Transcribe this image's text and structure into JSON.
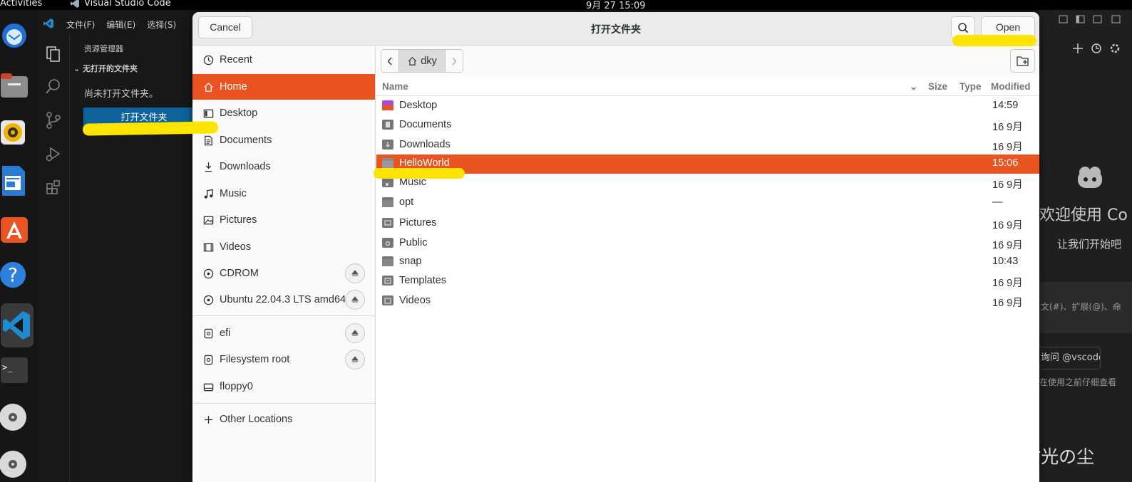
{
  "topbar": {
    "activities": "Activities",
    "app_name": "Visual Studio Code",
    "clock": "9月 27  15:09"
  },
  "dock": {
    "help_tooltip": "Help"
  },
  "vscode": {
    "menus": [
      "文件(F)",
      "编辑(E)",
      "选择(S)"
    ],
    "explorer_title": "资源管理器",
    "no_folder_section": "无打开的文件夹",
    "no_folder_message": "尚未打开文件夹。",
    "open_folder_button": "打开文件夹",
    "welcome_title": "欢迎使用 Co",
    "welcome_subtitle": "让我们开始吧",
    "chat_placeholder": "文(#)、扩展(@)、命",
    "ask_button": "询问 @vscode",
    "hint_text": "在使用之前仔细查看"
  },
  "dialog": {
    "title": "打开文件夹",
    "cancel_label": "Cancel",
    "open_label": "Open",
    "search_icon": "search-icon",
    "places": [
      {
        "label": "Recent",
        "icon": "clock-icon"
      },
      {
        "label": "Home",
        "icon": "home-icon",
        "selected": true
      },
      {
        "label": "Desktop",
        "icon": "desktop-icon"
      },
      {
        "label": "Documents",
        "icon": "document-icon"
      },
      {
        "label": "Downloads",
        "icon": "download-icon"
      },
      {
        "label": "Music",
        "icon": "music-icon"
      },
      {
        "label": "Pictures",
        "icon": "picture-icon"
      },
      {
        "label": "Videos",
        "icon": "video-icon"
      },
      {
        "label": "CDROM",
        "icon": "disc-icon",
        "eject": true
      },
      {
        "label": "Ubuntu 22.04.3 LTS amd64",
        "icon": "disc-icon",
        "eject": true
      },
      {
        "label": "efi",
        "icon": "drive-icon",
        "eject": true
      },
      {
        "label": "Filesystem root",
        "icon": "drive-icon",
        "eject": true
      },
      {
        "label": "floppy0",
        "icon": "floppy-icon"
      },
      {
        "label": "Other Locations",
        "icon": "plus-icon"
      }
    ],
    "path": {
      "current": "dky"
    },
    "columns": {
      "name": "Name",
      "size": "Size",
      "type": "Type",
      "modified": "Modified"
    },
    "files": [
      {
        "name": "Desktop",
        "modified": "14:59"
      },
      {
        "name": "Documents",
        "modified": "16 9月"
      },
      {
        "name": "Downloads",
        "modified": "16 9月"
      },
      {
        "name": "HelloWorld",
        "modified": "15:06",
        "selected": true
      },
      {
        "name": "Music",
        "modified": "16 9月"
      },
      {
        "name": "opt",
        "modified": "—"
      },
      {
        "name": "Pictures",
        "modified": "16 9月"
      },
      {
        "name": "Public",
        "modified": "16 9月"
      },
      {
        "name": "snap",
        "modified": "10:43"
      },
      {
        "name": "Templates",
        "modified": "16 9月"
      },
      {
        "name": "Videos",
        "modified": "16 9月"
      }
    ]
  },
  "watermark": "CSDN @时光の尘",
  "colors": {
    "accent": "#e95420",
    "highlight_marker": "#fde400",
    "vscode_button": "#0e639c"
  }
}
